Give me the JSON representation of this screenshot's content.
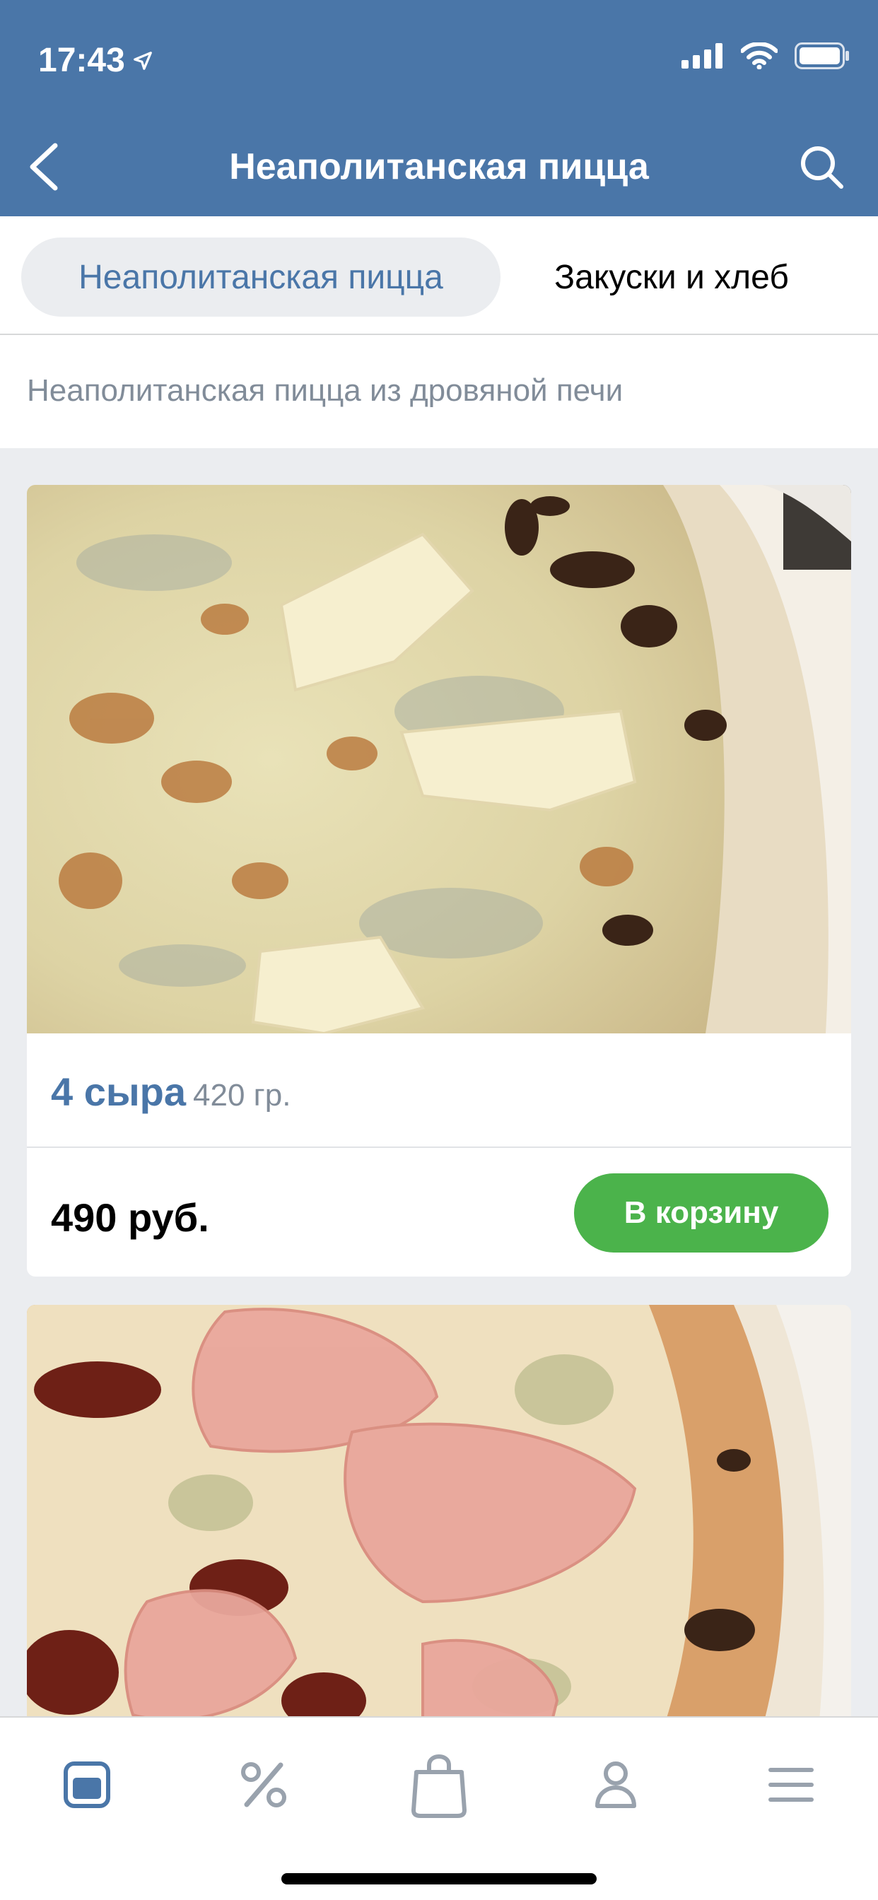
{
  "status_bar": {
    "time": "17:43",
    "icons": [
      "location-arrow-icon",
      "signal-icon",
      "wifi-icon",
      "battery-icon"
    ]
  },
  "navbar": {
    "title": "Неаполитанская пицца",
    "back_icon": "chevron-left-icon",
    "search_icon": "search-icon"
  },
  "tabs": [
    {
      "label": "Неаполитанская пицца",
      "active": true
    },
    {
      "label": "Закуски и хлеб",
      "active": false
    }
  ],
  "section": {
    "description": "Неаполитанская пицца из дровяной печи"
  },
  "products": [
    {
      "name": "4 сыра",
      "weight": "420 гр.",
      "price": "490 руб.",
      "button_label": "В корзину",
      "image": "pizza-four-cheese-photo"
    },
    {
      "image": "pizza-prosciutto-photo"
    }
  ],
  "tabbar": {
    "items": [
      "menu-icon",
      "percent-icon",
      "shopping-bag-icon",
      "profile-icon",
      "hamburger-icon"
    ]
  },
  "colors": {
    "header": "#4a76a8",
    "accent": "#4a76a8",
    "cart_button": "#4bb34b",
    "background": "#ebedf0"
  }
}
